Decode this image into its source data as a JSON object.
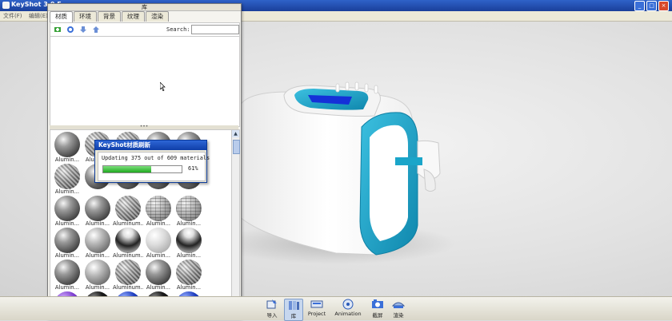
{
  "app": {
    "title": "KeyShot 3.0 F"
  },
  "menubar": {
    "items": [
      "文件(F)",
      "编辑(E)"
    ]
  },
  "library": {
    "title": "库",
    "tabs": [
      "材质",
      "环境",
      "背景",
      "纹理",
      "渲染"
    ],
    "active_tab": "材质",
    "toolbar": {
      "icons": [
        "add-material-icon",
        "refresh-icon",
        "download-icon",
        "upload-icon"
      ],
      "search_label": "Search:",
      "search_value": ""
    },
    "splitter_grip": "•••",
    "materials": [
      {
        "name": "Alumin...",
        "style": "dark"
      },
      {
        "name": "Alumin...",
        "style": "mesh"
      },
      {
        "name": "",
        "style": "mesh"
      },
      {
        "name": "",
        "style": "dark"
      },
      {
        "name": "",
        "style": "dark"
      },
      {
        "name": "Alumin...",
        "style": "mesh"
      },
      {
        "name": "",
        "style": "dark"
      },
      {
        "name": "",
        "style": "dark"
      },
      {
        "name": "",
        "style": "dark"
      },
      {
        "name": "",
        "style": "dark"
      },
      {
        "name": "Alumin...",
        "style": "dark"
      },
      {
        "name": "Alumin...",
        "style": "dark"
      },
      {
        "name": "Aluminum...",
        "style": "mesh"
      },
      {
        "name": "Alumin...",
        "style": "brick"
      },
      {
        "name": "Alumin...",
        "style": "brick"
      },
      {
        "name": "Alumin...",
        "style": "dark"
      },
      {
        "name": "Alumin...",
        "style": "mid"
      },
      {
        "name": "Aluminum...",
        "style": "chrome"
      },
      {
        "name": "Alumin...",
        "style": "light"
      },
      {
        "name": "Alumin...",
        "style": "chrome"
      },
      {
        "name": "Alumin...",
        "style": "dark"
      },
      {
        "name": "Alumin...",
        "style": "mid"
      },
      {
        "name": "Aluminum...",
        "style": "mesh"
      },
      {
        "name": "Alumin...",
        "style": "dark"
      },
      {
        "name": "Alumin...",
        "style": "mesh"
      },
      {
        "name": "",
        "style": "purple"
      },
      {
        "name": "",
        "style": "black"
      },
      {
        "name": "",
        "style": "blue"
      },
      {
        "name": "",
        "style": "black"
      },
      {
        "name": "",
        "style": "blue"
      }
    ]
  },
  "dialog": {
    "title": "KeyShot材质刷新",
    "message": "Updating 375 out of 609 materials",
    "progress": 0.61,
    "percent_label": "61%"
  },
  "toolbar": {
    "buttons": [
      {
        "label": "导入",
        "icon": "import-icon",
        "active": false
      },
      {
        "label": "库",
        "icon": "library-icon",
        "active": true
      },
      {
        "label": "Project",
        "icon": "project-icon",
        "active": false
      },
      {
        "label": "Animation",
        "icon": "animation-icon",
        "active": false
      },
      {
        "label": "截屏",
        "icon": "screenshot-icon",
        "active": false
      },
      {
        "label": "渲染",
        "icon": "render-icon",
        "active": false
      }
    ]
  },
  "colors": {
    "accent_teal": "#1aa5c9",
    "titlebar": "#1f4fb8",
    "progress": "#2eb82e"
  }
}
